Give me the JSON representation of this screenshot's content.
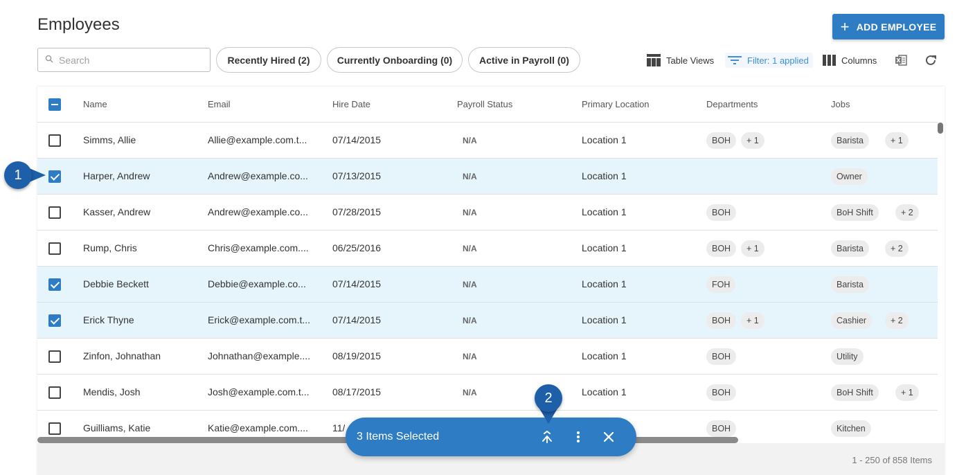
{
  "header": {
    "title": "Employees",
    "add_button": "ADD EMPLOYEE"
  },
  "search": {
    "placeholder": "Search"
  },
  "quick_filters": [
    "Recently Hired (2)",
    "Currently Onboarding (0)",
    "Active in Payroll (0)"
  ],
  "toolbar": {
    "table_views": "Table Views",
    "filter": "Filter: 1 applied",
    "columns": "Columns"
  },
  "table": {
    "columns": [
      "Name",
      "Email",
      "Hire Date",
      "Payroll Status",
      "Primary Location",
      "Departments",
      "Jobs"
    ],
    "rows": [
      {
        "name": "Simms, Allie",
        "email": "Allie@example.com.t...",
        "hire": "07/14/2015",
        "payroll": "N/A",
        "location": "Location 1",
        "dept": "BOH",
        "dept_more": "+ 1",
        "job": "Barista",
        "job_more": "+ 1",
        "checked": false
      },
      {
        "name": "Harper, Andrew",
        "email": "Andrew@example.co...",
        "hire": "07/13/2015",
        "payroll": "N/A",
        "location": "Location 1",
        "dept": "",
        "dept_more": "",
        "job": "Owner",
        "job_more": "",
        "checked": true
      },
      {
        "name": "Kasser, Andrew",
        "email": "Andrew@example.co...",
        "hire": "07/28/2015",
        "payroll": "N/A",
        "location": "Location 1",
        "dept": "BOH",
        "dept_more": "",
        "job": "BoH Shift",
        "job_more": "+ 2",
        "checked": false
      },
      {
        "name": "Rump, Chris",
        "email": "Chris@example.com....",
        "hire": "06/25/2016",
        "payroll": "N/A",
        "location": "Location 1",
        "dept": "BOH",
        "dept_more": "+ 1",
        "job": "Barista",
        "job_more": "+ 2",
        "checked": false
      },
      {
        "name": "Debbie Beckett",
        "email": "Debbie@example.co...",
        "hire": "07/14/2015",
        "payroll": "N/A",
        "location": "Location 1",
        "dept": "FOH",
        "dept_more": "",
        "job": "Barista",
        "job_more": "",
        "checked": true
      },
      {
        "name": "Erick Thyne",
        "email": "Erick@example.com.t...",
        "hire": "07/14/2015",
        "payroll": "N/A",
        "location": "Location 1",
        "dept": "BOH",
        "dept_more": "+ 1",
        "job": "Cashier",
        "job_more": "+ 2",
        "checked": true
      },
      {
        "name": "Zinfon, Johnathan",
        "email": "Johnathan@example....",
        "hire": "08/19/2015",
        "payroll": "N/A",
        "location": "Location 1",
        "dept": "BOH",
        "dept_more": "",
        "job": "Utility",
        "job_more": "",
        "checked": false
      },
      {
        "name": "Mendis, Josh",
        "email": "Josh@example.com.t...",
        "hire": "08/17/2015",
        "payroll": "N/A",
        "location": "Location 1",
        "dept": "BOH",
        "dept_more": "",
        "job": "BoH Shift",
        "job_more": "+ 1",
        "checked": false
      },
      {
        "name": "Guilliams, Katie",
        "email": "Katie@example.com....",
        "hire": "11/",
        "payroll": "",
        "location": "",
        "dept": "BOH",
        "dept_more": "",
        "job": "Kitchen",
        "job_more": "",
        "checked": false
      }
    ]
  },
  "pagination": "1 - 250 of 858 Items",
  "selection_bar": {
    "label": "3 Items Selected"
  },
  "callouts": [
    "1",
    "2"
  ],
  "colors": {
    "accent": "#2e7cc4",
    "callout": "#1d5fa8",
    "selected_row": "#e6f4fc"
  }
}
